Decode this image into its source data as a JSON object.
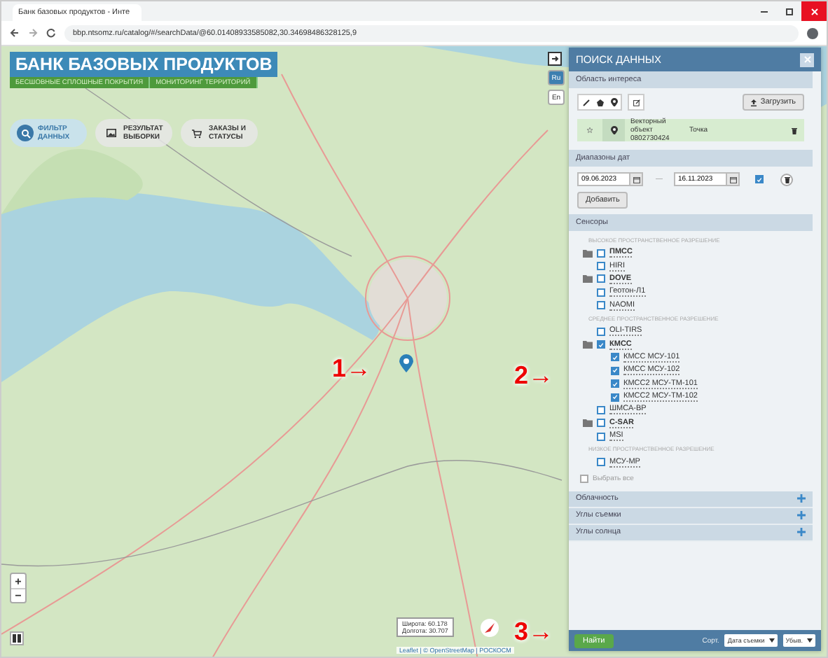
{
  "browser": {
    "tab_title": "Банк базовых продуктов - Инте",
    "url": "bbp.ntsomz.ru/catalog/#/searchData/@60.01408933585082,30.34698486328125,9"
  },
  "header": {
    "logo": "БАНК БАЗОВЫХ ПРОДУКТОВ",
    "subtitles": [
      "БЕСШОВНЫЕ СПЛОШНЫЕ ПОКРЫТИЯ",
      "МОНИТОРИНГ ТЕРРИТОРИЙ"
    ],
    "nav": [
      {
        "kind": "search",
        "label": "ФИЛЬТР ДАННЫХ",
        "selected": true
      },
      {
        "kind": "image",
        "label": "РЕЗУЛЬТАТ ВЫБОРКИ",
        "selected": false
      },
      {
        "kind": "cart",
        "label": "ЗАКАЗЫ И СТАТУСЫ",
        "selected": false
      }
    ]
  },
  "languages": [
    {
      "label": "Ru",
      "selected": true
    },
    {
      "label": "En",
      "selected": false
    }
  ],
  "map": {
    "coordinates": [
      "Широта: 60.178",
      "Долгота: 30.707"
    ],
    "attribution": "Leaflet | © OpenStreetMap | РОСКОСМ",
    "zoom_in": "+",
    "zoom_out": "−",
    "annotations": [
      {
        "label": "1→"
      },
      {
        "label": "2→"
      },
      {
        "label": "3→"
      }
    ]
  },
  "panel": {
    "title": "ПОИСК ДАННЫХ",
    "area": {
      "header": "Область интереса",
      "upload": "Загрузить",
      "object": {
        "name": "Векторный объект 0802730424",
        "type": "Точка"
      }
    },
    "dates": {
      "header": "Диапазоны дат",
      "from": "09.06.2023",
      "separator": "—",
      "to": "16.11.2023",
      "checked": true,
      "add": "Добавить"
    },
    "sensors": {
      "header": "Сенсоры",
      "items": [
        {
          "kind": "heading",
          "label": "ВЫСОКОЕ ПРОСТРАНСТВЕННОЕ РАЗРЕШЕНИЕ"
        },
        {
          "kind": "group",
          "label": "ПМСС",
          "checked": false
        },
        {
          "kind": "sensor",
          "label": "HIRI",
          "checked": false
        },
        {
          "kind": "group",
          "label": "DOVE",
          "checked": false
        },
        {
          "kind": "sensor",
          "label": "Геотон-Л1",
          "checked": false
        },
        {
          "kind": "sensor",
          "label": "NAOMI",
          "checked": false
        },
        {
          "kind": "heading",
          "label": "СРЕДНЕЕ ПРОСТРАНСТВЕННОЕ РАЗРЕШЕНИЕ"
        },
        {
          "kind": "sensor",
          "label": "OLI-TIRS",
          "checked": false
        },
        {
          "kind": "group",
          "label": "КМСС",
          "checked": true,
          "children": [
            {
              "kind": "sensor",
              "label": "КМСС МСУ-101",
              "checked": true
            },
            {
              "kind": "sensor",
              "label": "КМСС МСУ-102",
              "checked": true
            },
            {
              "kind": "sensor",
              "label": "КМСС2 МСУ-ТМ-101",
              "checked": true
            },
            {
              "kind": "sensor",
              "label": "КМСС2 МСУ-ТМ-102",
              "checked": true
            }
          ]
        },
        {
          "kind": "sensor",
          "label": "ШМСА-ВР",
          "checked": false
        },
        {
          "kind": "group",
          "label": "C-SAR",
          "checked": false
        },
        {
          "kind": "sensor",
          "label": "MSI",
          "checked": false
        },
        {
          "kind": "heading",
          "label": "НИЗКОЕ ПРОСТРАНСТВЕННОЕ РАЗРЕШЕНИЕ"
        },
        {
          "kind": "sensor",
          "label": "МСУ-МР",
          "checked": false
        }
      ],
      "select_all": {
        "label": "Выбрать все",
        "checked": false
      }
    },
    "filters": [
      "Облачность",
      "Углы съемки",
      "Углы солнца"
    ],
    "footer": {
      "find": "Найти",
      "sort_label": "Сорт.",
      "sort_by": "Дата съемки",
      "order": "Убыв."
    }
  }
}
